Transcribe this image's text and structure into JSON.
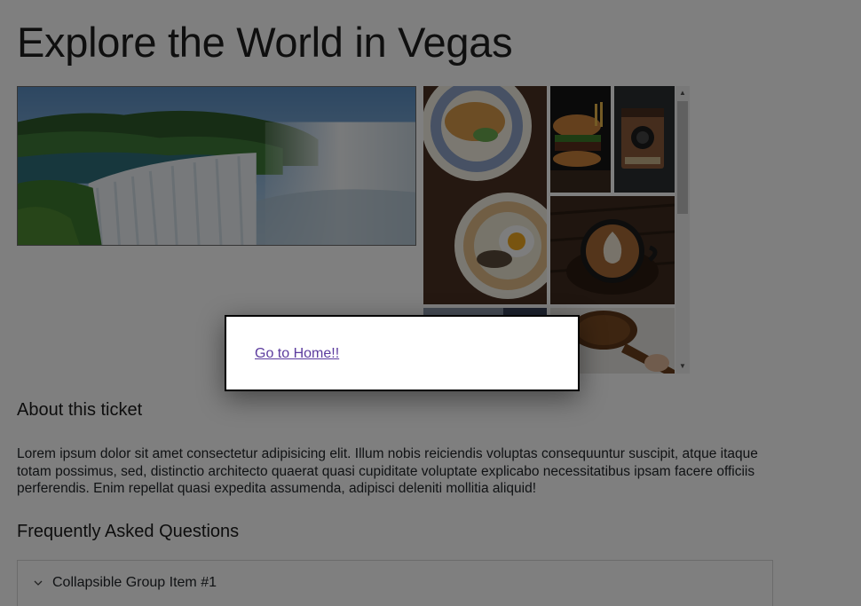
{
  "page": {
    "title": "Explore the World in Vegas"
  },
  "images": {
    "hero": "waterfall-photo",
    "gallery": [
      "breakfast-plates-photo",
      "burger-photo",
      "vintage-camera-photo",
      "latte-art-photo",
      "blue-tone-photo",
      "honey-dipper-photo"
    ]
  },
  "about": {
    "heading": "About this ticket",
    "body": "Lorem ipsum dolor sit amet consectetur adipisicing elit. Illum nobis reiciendis voluptas consequuntur suscipit, atque itaque totam possimus, sed, distinctio architecto quaerat quasi cupiditate voluptate explicabo necessitatibus ipsam facere officiis perferendis. Enim repellat quasi expedita assumenda, adipisci deleniti mollitia aliquid!"
  },
  "faq": {
    "heading": "Frequently Asked Questions",
    "items": [
      {
        "label": "Collapsible Group Item #1",
        "icon": "chevron-down-icon"
      }
    ]
  },
  "modal": {
    "link_label": "Go to Home!!"
  },
  "colors": {
    "overlay": "#000000",
    "link": "#5c3c9e",
    "modal_border": "#000000"
  }
}
